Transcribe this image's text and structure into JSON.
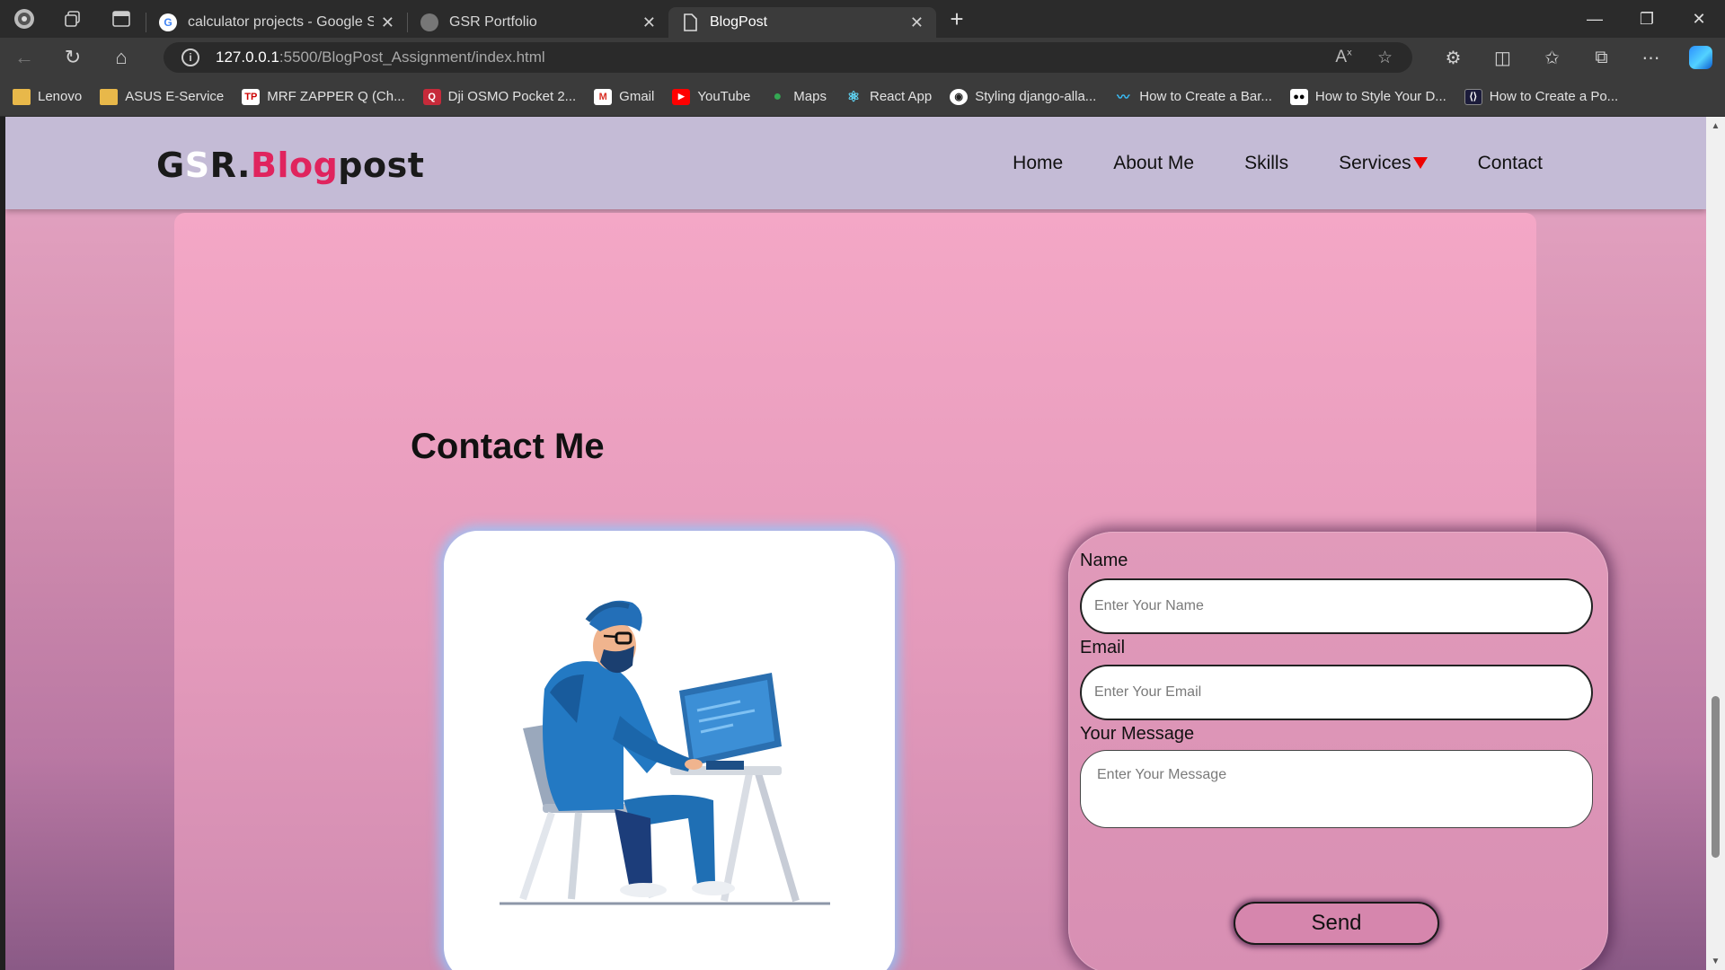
{
  "browser": {
    "tabs": [
      {
        "title": "calculator projects - Google Sear",
        "icon": "google-icon",
        "active": false
      },
      {
        "title": "GSR Portfolio",
        "icon": "portfolio-icon",
        "active": false
      },
      {
        "title": "BlogPost",
        "icon": "page-icon",
        "active": true
      }
    ],
    "url_host": "127.0.0.1",
    "url_path": ":5500/BlogPost_Assignment/index.html",
    "bookmarks": [
      {
        "label": "Lenovo",
        "icon": "folder-icon"
      },
      {
        "label": "ASUS E-Service",
        "icon": "folder-icon"
      },
      {
        "label": "MRF ZAPPER Q (Ch...",
        "icon": "tp-icon"
      },
      {
        "label": "Dji OSMO Pocket 2...",
        "icon": "q-icon"
      },
      {
        "label": "Gmail",
        "icon": "gmail-icon"
      },
      {
        "label": "YouTube",
        "icon": "youtube-icon"
      },
      {
        "label": "Maps",
        "icon": "maps-icon"
      },
      {
        "label": "React App",
        "icon": "react-icon"
      },
      {
        "label": "Styling django-alla...",
        "icon": "github-icon"
      },
      {
        "label": "How to Create a Bar...",
        "icon": "tailwind-icon"
      },
      {
        "label": "How to Style Your D...",
        "icon": "medium-icon"
      },
      {
        "label": "How to Create a Po...",
        "icon": "dev-icon"
      }
    ]
  },
  "site": {
    "logo": {
      "g": "G",
      "s": "S",
      "r": "R.",
      "blog": "Blog",
      "post": "post"
    },
    "nav": {
      "home": "Home",
      "about": "About Me",
      "skills": "Skills",
      "services": "Services",
      "contact": "Contact"
    },
    "contact_title": "Contact Me",
    "form": {
      "name_label": "Name",
      "name_placeholder": "Enter Your Name",
      "email_label": "Email",
      "email_placeholder": "Enter Your Email",
      "message_label": "Your Message",
      "message_placeholder": "Enter Your Message",
      "send_label": "Send"
    },
    "accent_color": "#e0245e",
    "caret_color": "#ee0000"
  }
}
